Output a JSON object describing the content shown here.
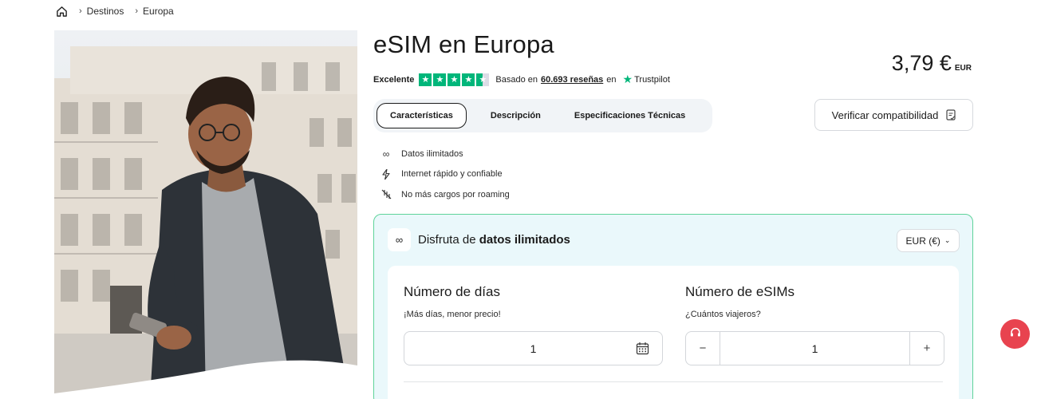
{
  "breadcrumb": {
    "items": [
      "Destinos",
      "Europa"
    ]
  },
  "product": {
    "title": "eSIM en Europa",
    "price": "3,79 €",
    "currency_code": "EUR"
  },
  "rating": {
    "label": "Excelente",
    "stars": 4.5,
    "based_on": "Basado en",
    "reviews": "60.693 reseñas",
    "on": "en",
    "provider": "Trustpilot",
    "color": "#00b67a"
  },
  "tabs": [
    {
      "label": "Características",
      "active": true
    },
    {
      "label": "Descripción",
      "active": false
    },
    {
      "label": "Especificaciones Técnicas",
      "active": false
    }
  ],
  "verify_button": "Verificar compatibilidad",
  "features": [
    {
      "icon": "infinity-icon",
      "label": "Datos ilimitados"
    },
    {
      "icon": "lightning-icon",
      "label": "Internet rápido y confiable"
    },
    {
      "icon": "no-roaming-icon",
      "label": "No más cargos por roaming"
    }
  ],
  "plan": {
    "heading_prefix": "Disfruta de",
    "heading_bold": "datos ilimitados",
    "currency_select": "EUR (€)",
    "accent_border": "#5fd39a",
    "background": "#eaf8fb",
    "days": {
      "title": "Número de días",
      "subtitle": "¡Más días, menor precio!",
      "value": "1"
    },
    "esims": {
      "title": "Número de eSIMs",
      "subtitle": "¿Cuántos viajeros?",
      "value": "1",
      "minus": "−",
      "plus": "+"
    }
  },
  "help_button_color": "#e8434f"
}
